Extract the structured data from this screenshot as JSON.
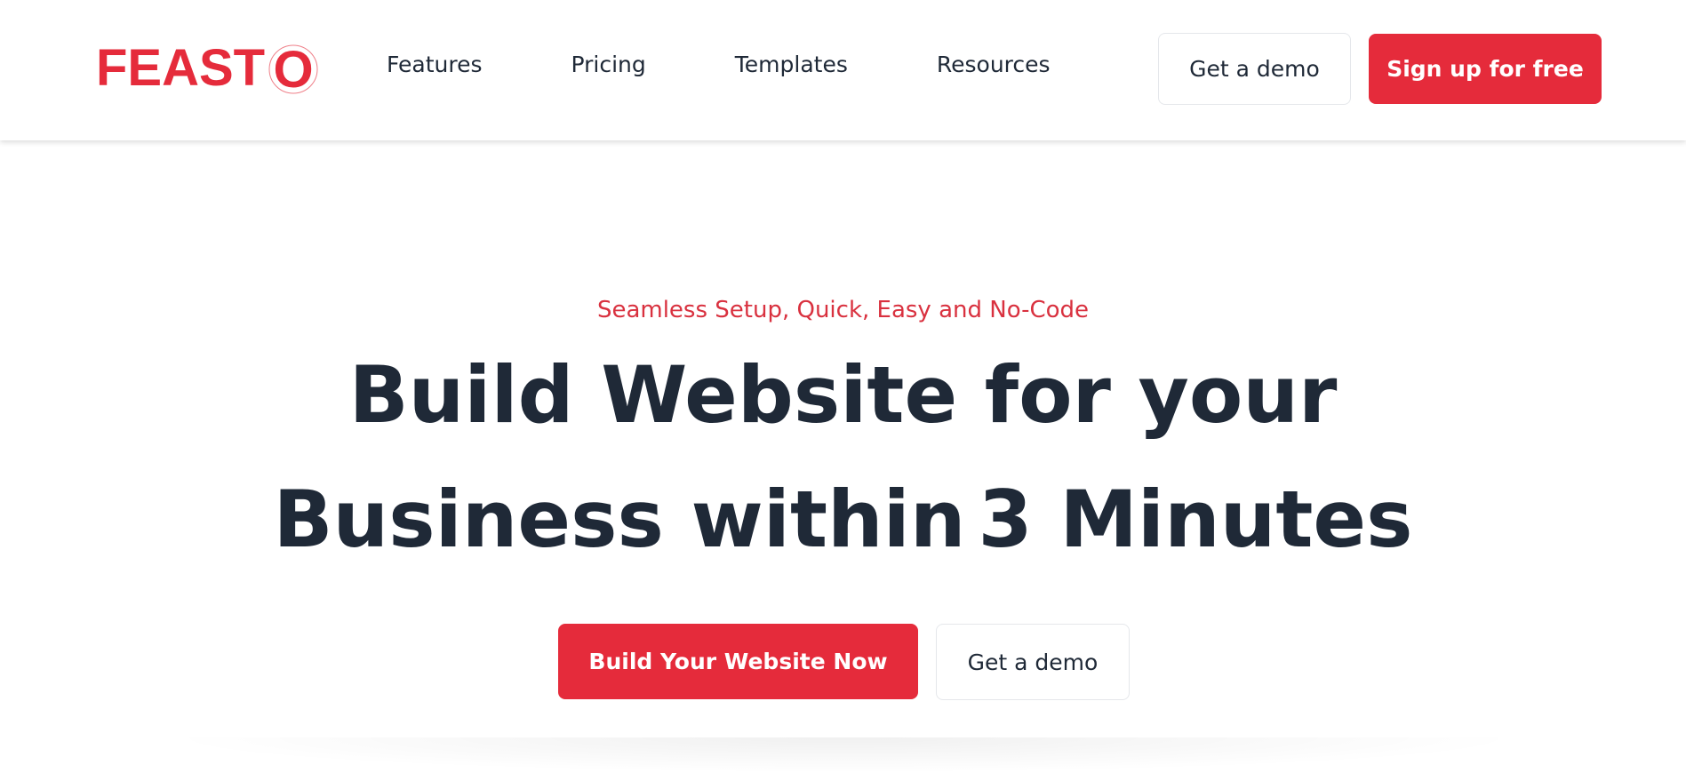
{
  "colors": {
    "accent": "#e52b3b",
    "text_dark": "#1f2937",
    "tagline": "#d9313f",
    "border": "#e5e7eb"
  },
  "header": {
    "logo_text": "FEAST",
    "logo_last_letter": "O",
    "nav": [
      {
        "label": "Features"
      },
      {
        "label": "Pricing"
      },
      {
        "label": "Templates"
      },
      {
        "label": "Resources"
      }
    ],
    "demo_label": "Get a demo",
    "signup_label": "Sign up for free"
  },
  "hero": {
    "tagline": "Seamless Setup, Quick, Easy and No-Code",
    "headline_line1": "Build Website for your",
    "headline_line2_prefix": "Business within",
    "headline_highlight": "3 Minutes",
    "primary_cta": "Build Your Website Now",
    "secondary_cta": "Get a demo"
  }
}
